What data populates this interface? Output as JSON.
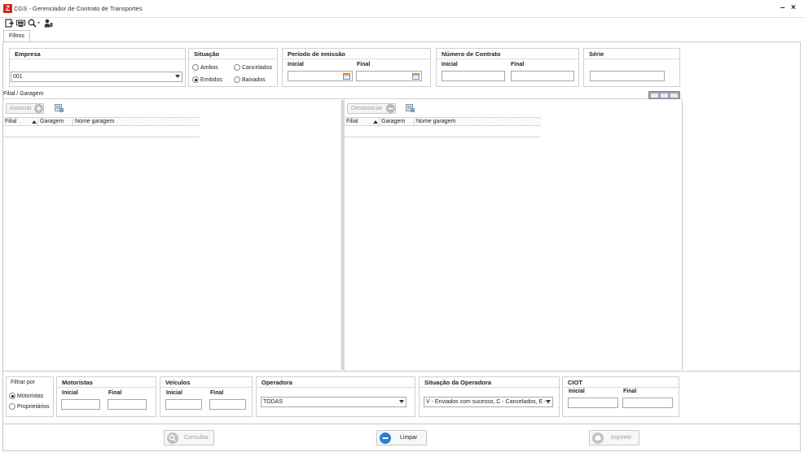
{
  "window": {
    "title": "CGS - Gerenciador de Contrato de Transportes",
    "minimize": "–",
    "close": "×",
    "logo": "Z"
  },
  "tabs": [
    {
      "label": "Filtros"
    }
  ],
  "empresa": {
    "title": "Empresa",
    "value": "001"
  },
  "situacao": {
    "title": "Situação",
    "options": [
      "Ambos",
      "Cancelados",
      "Emitidos",
      "Baixados"
    ],
    "selected": "Emitidos"
  },
  "periodo": {
    "title": "Período de emissão",
    "inicial": "Inicial",
    "final": "Final"
  },
  "numero_contrato": {
    "title": "Número de Contrato",
    "inicial": "Inicial",
    "final": "Final"
  },
  "serie": {
    "title": "Série"
  },
  "filial_garagem": {
    "title": "Filial / Garagem",
    "associar": "Associar",
    "desassociar": "Desassociar",
    "columns": [
      "Filial",
      "Garagem",
      "Nome garagem"
    ]
  },
  "filtrar_por": {
    "title": "Filtrar por",
    "options": [
      "Motoristas",
      "Proprietários"
    ],
    "selected": "Motoristas"
  },
  "motoristas": {
    "title": "Motoristas",
    "inicial": "Inicial",
    "final": "Final"
  },
  "veiculos": {
    "title": "Veículos",
    "inicial": "Inicial",
    "final": "Final"
  },
  "operadora": {
    "title": "Operadora",
    "value": "TODAS"
  },
  "situacao_operadora": {
    "title": "Situação da Operadora",
    "value": "V - Enviados com sucesso, C - Cancelados, E -..."
  },
  "ciot": {
    "title": "CIOT",
    "inicial": "Inicial",
    "final": "Final"
  },
  "buttons": {
    "consultar": "Consultar",
    "limpar": "Limpar",
    "imprimir": "Imprimir"
  },
  "colors": {
    "accent_red": "#d9231d",
    "limpar_blue": "#2a7ed6",
    "disabled_gray": "#a0a0a0"
  }
}
